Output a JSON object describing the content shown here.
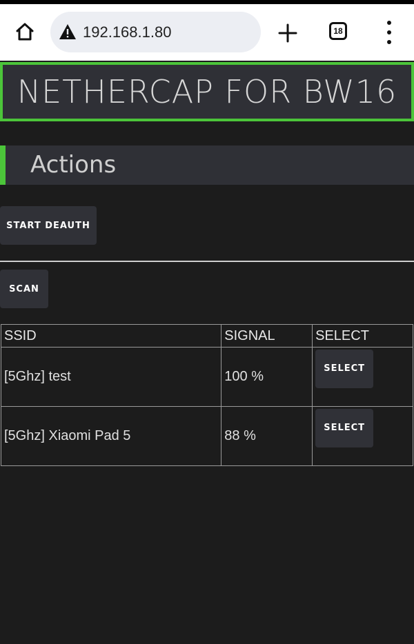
{
  "browser": {
    "url": "192.168.1.80",
    "tab_count": "18"
  },
  "page": {
    "title": "NETHERCAP FOR BW16",
    "section_title": "Actions",
    "start_deauth_label": "START DEAUTH",
    "scan_label": "SCAN",
    "table": {
      "headers": [
        "SSID",
        "SIGNAL",
        "SELECT"
      ],
      "rows": [
        {
          "ssid": "[5Ghz] test",
          "signal": "100 %",
          "select_label": "SELECT"
        },
        {
          "ssid": "[5Ghz] Xiaomi Pad 5",
          "signal": "88 %",
          "select_label": "SELECT"
        }
      ]
    }
  },
  "colors": {
    "accent": "#4cc53a",
    "panel": "#2f3036",
    "background": "#1c1c1c"
  },
  "icons": {
    "home": "home-icon",
    "warning": "warning-icon",
    "new_tab": "plus-icon",
    "tabs": "tabs-icon",
    "menu": "kebab-menu-icon"
  }
}
